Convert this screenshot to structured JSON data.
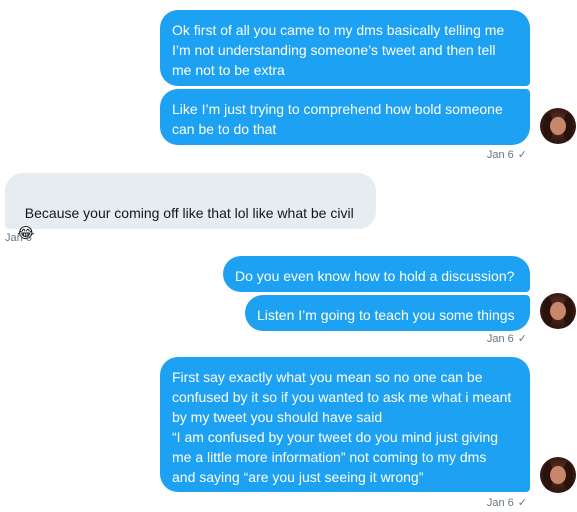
{
  "messages": [
    {
      "id": "m1",
      "direction": "sent",
      "text": "Ok first of all you came to my dms basically telling me\nI’m not understanding someone’s tweet and then tell\nme not to be extra"
    },
    {
      "id": "m2",
      "direction": "sent",
      "text": "Like I’m just trying to comprehend how bold someone\ncan be to do that"
    },
    {
      "id": "m3",
      "direction": "received",
      "text": "Because your coming off like that lol like what be civil",
      "emoji": "😂"
    },
    {
      "id": "m4",
      "direction": "sent",
      "text": "Do you even know how to hold a discussion?"
    },
    {
      "id": "m5",
      "direction": "sent",
      "text": "Listen I’m going to teach you some things"
    },
    {
      "id": "m6",
      "direction": "sent",
      "text": "First say exactly what you mean so no one can be\nconfused by it so if you wanted to ask me what i meant\nby my tweet you should have said\n“I am confused by your tweet do you mind just giving\nme a little more information” not coming to my dms\nand saying “are you just seeing it wrong”"
    }
  ],
  "timestamps": {
    "group1": "Jan 6",
    "group2": "Jan 6",
    "group3": "Jan 6",
    "group4": "Jan 6"
  },
  "check_mark": "✓"
}
